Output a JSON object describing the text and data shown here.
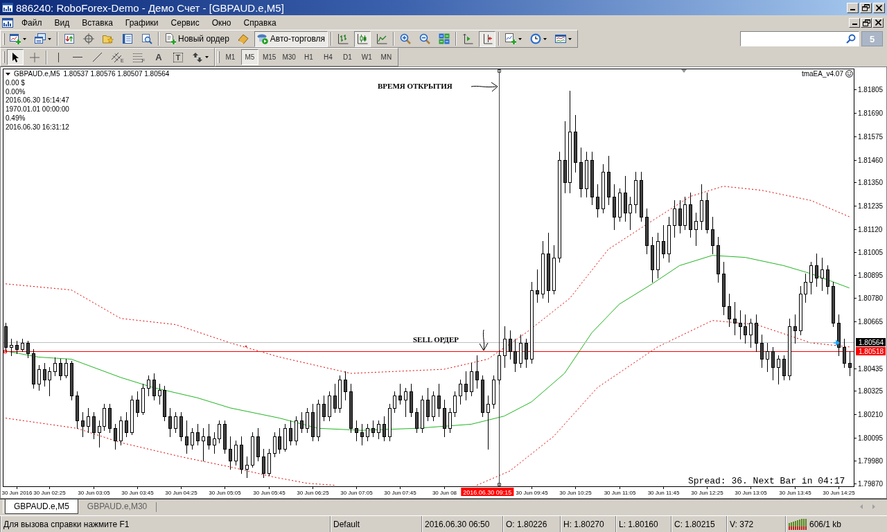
{
  "window": {
    "title": "886240: RoboForex-Demo - Демо Счет - [GBPAUD.e,M5]"
  },
  "menu": {
    "items": [
      "Файл",
      "Вид",
      "Вставка",
      "Графики",
      "Сервис",
      "Окно",
      "Справка"
    ]
  },
  "toolbar": {
    "groups": [
      [
        {
          "kind": "new-chart",
          "pressed": false,
          "dropdown": true
        },
        {
          "kind": "profiles",
          "pressed": false,
          "dropdown": true
        }
      ],
      [
        {
          "kind": "market-watch",
          "pressed": false
        },
        {
          "kind": "navigator",
          "pressed": false
        },
        {
          "kind": "favorites",
          "pressed": false
        },
        {
          "kind": "terminal",
          "pressed": false
        },
        {
          "kind": "tester",
          "pressed": false
        }
      ],
      [
        {
          "kind": "new-order",
          "label": "Новый ордер",
          "pressed": false
        },
        {
          "kind": "meta-editor",
          "pressed": false
        },
        {
          "kind": "auto-trading",
          "label": "Авто-торговля",
          "pressed": true
        }
      ],
      [
        {
          "kind": "bar-chart",
          "pressed": false
        },
        {
          "kind": "candles",
          "pressed": true
        },
        {
          "kind": "line-chart",
          "pressed": false
        }
      ],
      [
        {
          "kind": "zoom-in",
          "pressed": false
        },
        {
          "kind": "zoom-out",
          "pressed": false
        },
        {
          "kind": "tile",
          "pressed": false
        }
      ],
      [
        {
          "kind": "autoscroll",
          "pressed": false
        },
        {
          "kind": "chart-shift",
          "pressed": true
        }
      ],
      [
        {
          "kind": "indicators",
          "pressed": false,
          "dropdown": true
        },
        {
          "kind": "periods",
          "pressed": false,
          "dropdown": true
        },
        {
          "kind": "templates",
          "pressed": false,
          "dropdown": true
        }
      ]
    ],
    "messages": {
      "count": "5"
    }
  },
  "drawing_toolbar": {
    "groups": [
      [
        {
          "kind": "cursor",
          "pressed": true
        },
        {
          "kind": "crosshair",
          "pressed": false
        }
      ],
      [
        {
          "kind": "vline",
          "pressed": false
        },
        {
          "kind": "hline",
          "pressed": false
        },
        {
          "kind": "trendline",
          "pressed": false
        },
        {
          "kind": "channel",
          "letter": "E",
          "pressed": false
        },
        {
          "kind": "fibo",
          "letter": "F",
          "pressed": false
        },
        {
          "kind": "text",
          "label": "A",
          "pressed": false
        },
        {
          "kind": "label",
          "label": "T",
          "pressed": false
        },
        {
          "kind": "arrows",
          "pressed": false,
          "dropdown": true
        }
      ]
    ],
    "timeframes": [
      {
        "label": "M1",
        "selected": false
      },
      {
        "label": "M5",
        "selected": true
      },
      {
        "label": "M15",
        "selected": false
      },
      {
        "label": "M30",
        "selected": false
      },
      {
        "label": "H1",
        "selected": false
      },
      {
        "label": "H4",
        "selected": false
      },
      {
        "label": "D1",
        "selected": false
      },
      {
        "label": "W1",
        "selected": false
      },
      {
        "label": "MN",
        "selected": false
      }
    ]
  },
  "chart": {
    "header": {
      "symbol": "GBPAUD.e,M5",
      "quotes": "1.80537 1.80576 1.80507 1.80564"
    },
    "info_lines": [
      "0.00 $",
      "0.00%",
      "2016.06.30 16:14:47",
      "1970.01.01 00:00:00",
      "0.49%",
      "2016.06.30 16:31:12"
    ],
    "expert": {
      "name": "tmaEA_v4.07",
      "smiling": true
    },
    "ref_line_states": [
      {
        "selected": false
      },
      {
        "selected": true
      },
      {
        "selected": true
      }
    ],
    "chart_data": {
      "type": "candlestick",
      "x": [
        "2016-06-30T01:45",
        "2016-06-30T01:50",
        "2016-06-30T01:55",
        "2016-06-30T02:00",
        "2016-06-30T02:05",
        "2016-06-30T02:10",
        "2016-06-30T02:15",
        "2016-06-30T02:20",
        "2016-06-30T02:25",
        "2016-06-30T02:30",
        "2016-06-30T02:35",
        "2016-06-30T02:40",
        "2016-06-30T02:45",
        "2016-06-30T02:50",
        "2016-06-30T02:55",
        "2016-06-30T03:00",
        "2016-06-30T03:05",
        "2016-06-30T03:10",
        "2016-06-30T03:15",
        "2016-06-30T03:20",
        "2016-06-30T03:25",
        "2016-06-30T03:30",
        "2016-06-30T03:35",
        "2016-06-30T03:40",
        "2016-06-30T03:45",
        "2016-06-30T03:50",
        "2016-06-30T03:55",
        "2016-06-30T04:00",
        "2016-06-30T04:05",
        "2016-06-30T04:10",
        "2016-06-30T04:15",
        "2016-06-30T04:20",
        "2016-06-30T04:25",
        "2016-06-30T04:30",
        "2016-06-30T04:35",
        "2016-06-30T04:40",
        "2016-06-30T04:45",
        "2016-06-30T04:50",
        "2016-06-30T04:55",
        "2016-06-30T05:00",
        "2016-06-30T05:05",
        "2016-06-30T05:10",
        "2016-06-30T05:15",
        "2016-06-30T05:20",
        "2016-06-30T05:25",
        "2016-06-30T05:30",
        "2016-06-30T05:35",
        "2016-06-30T05:40",
        "2016-06-30T05:45",
        "2016-06-30T05:50",
        "2016-06-30T05:55",
        "2016-06-30T06:00",
        "2016-06-30T06:05",
        "2016-06-30T06:10",
        "2016-06-30T06:15",
        "2016-06-30T06:20",
        "2016-06-30T06:25",
        "2016-06-30T06:30",
        "2016-06-30T06:35",
        "2016-06-30T06:40",
        "2016-06-30T06:45",
        "2016-06-30T06:50",
        "2016-06-30T06:55",
        "2016-06-30T07:00",
        "2016-06-30T07:05",
        "2016-06-30T07:10",
        "2016-06-30T07:15",
        "2016-06-30T07:20",
        "2016-06-30T07:25",
        "2016-06-30T07:30",
        "2016-06-30T07:35",
        "2016-06-30T07:40",
        "2016-06-30T07:45",
        "2016-06-30T07:50",
        "2016-06-30T07:55",
        "2016-06-30T08:00",
        "2016-06-30T08:05",
        "2016-06-30T08:10",
        "2016-06-30T08:15",
        "2016-06-30T08:20",
        "2016-06-30T08:25",
        "2016-06-30T08:30",
        "2016-06-30T08:35",
        "2016-06-30T08:40",
        "2016-06-30T08:45",
        "2016-06-30T08:50",
        "2016-06-30T08:55",
        "2016-06-30T09:00",
        "2016-06-30T09:05",
        "2016-06-30T09:10",
        "2016-06-30T09:15",
        "2016-06-30T09:20",
        "2016-06-30T09:25",
        "2016-06-30T09:30",
        "2016-06-30T09:35",
        "2016-06-30T09:40",
        "2016-06-30T09:45",
        "2016-06-30T09:50",
        "2016-06-30T09:55",
        "2016-06-30T10:00",
        "2016-06-30T10:05",
        "2016-06-30T10:10",
        "2016-06-30T10:15",
        "2016-06-30T10:20",
        "2016-06-30T10:25",
        "2016-06-30T10:30",
        "2016-06-30T10:35",
        "2016-06-30T10:40",
        "2016-06-30T10:45",
        "2016-06-30T10:50",
        "2016-06-30T10:55",
        "2016-06-30T11:00",
        "2016-06-30T11:05",
        "2016-06-30T11:10",
        "2016-06-30T11:15",
        "2016-06-30T11:20",
        "2016-06-30T11:25",
        "2016-06-30T11:30",
        "2016-06-30T11:35",
        "2016-06-30T11:40",
        "2016-06-30T11:45",
        "2016-06-30T11:50",
        "2016-06-30T11:55",
        "2016-06-30T12:00",
        "2016-06-30T12:05",
        "2016-06-30T12:10",
        "2016-06-30T12:15",
        "2016-06-30T12:20",
        "2016-06-30T12:25",
        "2016-06-30T12:30",
        "2016-06-30T12:35",
        "2016-06-30T12:40",
        "2016-06-30T12:45",
        "2016-06-30T12:50",
        "2016-06-30T12:55",
        "2016-06-30T13:00",
        "2016-06-30T13:05",
        "2016-06-30T13:10",
        "2016-06-30T13:15",
        "2016-06-30T13:20",
        "2016-06-30T13:25",
        "2016-06-30T13:30",
        "2016-06-30T13:35",
        "2016-06-30T13:40",
        "2016-06-30T13:45",
        "2016-06-30T13:50",
        "2016-06-30T13:55",
        "2016-06-30T14:00",
        "2016-06-30T14:05",
        "2016-06-30T14:10",
        "2016-06-30T14:15",
        "2016-06-30T14:20",
        "2016-06-30T14:25",
        "2016-06-30T14:30",
        "2016-06-30T14:35"
      ],
      "ohlc": [
        [
          1.8064,
          1.8066,
          1.8052,
          1.8054
        ],
        [
          1.8054,
          1.8058,
          1.805,
          1.8055
        ],
        [
          1.8055,
          1.8057,
          1.8051,
          1.8053
        ],
        [
          1.8053,
          1.8058,
          1.8052,
          1.8056
        ],
        [
          1.8056,
          1.8057,
          1.8049,
          1.8051
        ],
        [
          1.8051,
          1.8053,
          1.8034,
          1.8036
        ],
        [
          1.8036,
          1.8045,
          1.8033,
          1.8043
        ],
        [
          1.8043,
          1.8046,
          1.8035,
          1.8038
        ],
        [
          1.8038,
          1.8044,
          1.803,
          1.8042
        ],
        [
          1.8042,
          1.8049,
          1.804,
          1.8046
        ],
        [
          1.8046,
          1.8048,
          1.8038,
          1.804
        ],
        [
          1.804,
          1.8048,
          1.8039,
          1.8046
        ],
        [
          1.8046,
          1.8047,
          1.8028,
          1.803
        ],
        [
          1.803,
          1.8032,
          1.8014,
          1.8018
        ],
        [
          1.8018,
          1.8022,
          1.801,
          1.8015
        ],
        [
          1.8015,
          1.8024,
          1.8012,
          1.802
        ],
        [
          1.802,
          1.8022,
          1.8009,
          1.8012
        ],
        [
          1.8012,
          1.8018,
          1.8005,
          1.8015
        ],
        [
          1.8015,
          1.8026,
          1.8013,
          1.8024
        ],
        [
          1.8024,
          1.8026,
          1.8012,
          1.8014
        ],
        [
          1.8014,
          1.8016,
          1.8004,
          1.8008
        ],
        [
          1.8008,
          1.802,
          1.8006,
          1.8018
        ],
        [
          1.8018,
          1.8022,
          1.801,
          1.8012
        ],
        [
          1.8012,
          1.803,
          1.8011,
          1.8028
        ],
        [
          1.8028,
          1.8032,
          1.802,
          1.8022
        ],
        [
          1.8022,
          1.8036,
          1.8021,
          1.8034
        ],
        [
          1.8034,
          1.804,
          1.803,
          1.8038
        ],
        [
          1.8038,
          1.8041,
          1.8028,
          1.803
        ],
        [
          1.803,
          1.8036,
          1.8026,
          1.8033
        ],
        [
          1.8033,
          1.8035,
          1.8018,
          1.802
        ],
        [
          1.802,
          1.8024,
          1.801,
          1.8014
        ],
        [
          1.8014,
          1.8022,
          1.8012,
          1.802
        ],
        [
          1.802,
          1.8022,
          1.8008,
          1.801
        ],
        [
          1.801,
          1.8018,
          1.8002,
          1.8006
        ],
        [
          1.8006,
          1.8014,
          1.8004,
          1.8012
        ],
        [
          1.8012,
          1.8016,
          1.8006,
          1.8008
        ],
        [
          1.8008,
          1.8014,
          1.7998,
          1.801
        ],
        [
          1.801,
          1.8016,
          1.8004,
          1.8006
        ],
        [
          1.8006,
          1.8012,
          1.8002,
          1.8009
        ],
        [
          1.8009,
          1.8018,
          1.8007,
          1.8016
        ],
        [
          1.8016,
          1.8018,
          1.8002,
          1.8004
        ],
        [
          1.8004,
          1.801,
          1.7994,
          1.7998
        ],
        [
          1.7998,
          1.8008,
          1.7996,
          1.8006
        ],
        [
          1.8006,
          1.801,
          1.7992,
          1.7994
        ],
        [
          1.7994,
          1.8,
          1.799,
          1.7996
        ],
        [
          1.7996,
          1.8012,
          1.7995,
          1.801
        ],
        [
          1.801,
          1.8014,
          1.7998,
          1.8
        ],
        [
          1.8,
          1.8004,
          1.799,
          1.7992
        ],
        [
          1.7992,
          1.8004,
          1.7991,
          1.8002
        ],
        [
          1.8002,
          1.8012,
          1.8,
          1.801
        ],
        [
          1.801,
          1.8014,
          1.8002,
          1.8004
        ],
        [
          1.8004,
          1.8016,
          1.8003,
          1.8014
        ],
        [
          1.8014,
          1.8018,
          1.8006,
          1.8008
        ],
        [
          1.8008,
          1.802,
          1.8006,
          1.8018
        ],
        [
          1.8018,
          1.8022,
          1.8012,
          1.8014
        ],
        [
          1.8014,
          1.8024,
          1.8012,
          1.8022
        ],
        [
          1.8022,
          1.8026,
          1.8008,
          1.801
        ],
        [
          1.801,
          1.8028,
          1.8008,
          1.8026
        ],
        [
          1.8026,
          1.803,
          1.8018,
          1.802
        ],
        [
          1.802,
          1.8032,
          1.8018,
          1.803
        ],
        [
          1.803,
          1.8036,
          1.8022,
          1.8024
        ],
        [
          1.8024,
          1.804,
          1.8022,
          1.8038
        ],
        [
          1.8038,
          1.8042,
          1.8028,
          1.8032
        ],
        [
          1.8032,
          1.8036,
          1.8012,
          1.8014
        ],
        [
          1.8014,
          1.8018,
          1.8008,
          1.8012
        ],
        [
          1.8012,
          1.8016,
          1.8006,
          1.801
        ],
        [
          1.801,
          1.8016,
          1.8008,
          1.8014
        ],
        [
          1.8014,
          1.8018,
          1.801,
          1.8012
        ],
        [
          1.8012,
          1.8018,
          1.8009,
          1.8016
        ],
        [
          1.8016,
          1.802,
          1.8008,
          1.801
        ],
        [
          1.801,
          1.8026,
          1.8008,
          1.8024
        ],
        [
          1.8024,
          1.8032,
          1.8022,
          1.803
        ],
        [
          1.803,
          1.8036,
          1.8026,
          1.8028
        ],
        [
          1.8028,
          1.8034,
          1.802,
          1.8032
        ],
        [
          1.8032,
          1.8036,
          1.802,
          1.8022
        ],
        [
          1.8022,
          1.8024,
          1.8012,
          1.8014
        ],
        [
          1.8014,
          1.803,
          1.8012,
          1.8028
        ],
        [
          1.8028,
          1.8034,
          1.8018,
          1.802
        ],
        [
          1.802,
          1.8032,
          1.8018,
          1.803
        ],
        [
          1.803,
          1.8036,
          1.802,
          1.8024
        ],
        [
          1.8024,
          1.8028,
          1.801,
          1.8014
        ],
        [
          1.8014,
          1.8024,
          1.8012,
          1.8022
        ],
        [
          1.8022,
          1.8032,
          1.802,
          1.803
        ],
        [
          1.803,
          1.8038,
          1.8026,
          1.8036
        ],
        [
          1.8036,
          1.8042,
          1.8028,
          1.8032
        ],
        [
          1.8032,
          1.8046,
          1.803,
          1.8042
        ],
        [
          1.8042,
          1.805,
          1.8034,
          1.8038
        ],
        [
          1.8038,
          1.804,
          1.802,
          1.8022
        ],
        [
          1.8022,
          1.803,
          1.8004,
          1.8026
        ],
        [
          1.8026,
          1.804,
          1.8024,
          1.8038
        ],
        [
          1.8038,
          1.8052,
          1.8036,
          1.805
        ],
        [
          1.805,
          1.8064,
          1.8044,
          1.8058
        ],
        [
          1.8058,
          1.8062,
          1.8048,
          1.8052
        ],
        [
          1.8052,
          1.8058,
          1.8042,
          1.8046
        ],
        [
          1.8046,
          1.806,
          1.8044,
          1.8056
        ],
        [
          1.8056,
          1.8058,
          1.8044,
          1.8048
        ],
        [
          1.8048,
          1.8086,
          1.8046,
          1.8082
        ],
        [
          1.8082,
          1.8092,
          1.8076,
          1.808
        ],
        [
          1.808,
          1.8106,
          1.8078,
          1.81
        ],
        [
          1.81,
          1.811,
          1.8076,
          1.8082
        ],
        [
          1.8082,
          1.8104,
          1.808,
          1.8098
        ],
        [
          1.8098,
          1.815,
          1.8096,
          1.8146
        ],
        [
          1.8146,
          1.8165,
          1.813,
          1.8135
        ],
        [
          1.8135,
          1.818,
          1.813,
          1.816
        ],
        [
          1.816,
          1.8168,
          1.814,
          1.8145
        ],
        [
          1.8145,
          1.8152,
          1.8128,
          1.8132
        ],
        [
          1.8132,
          1.815,
          1.8128,
          1.8146
        ],
        [
          1.8146,
          1.815,
          1.8124,
          1.8128
        ],
        [
          1.8128,
          1.8134,
          1.8118,
          1.8122
        ],
        [
          1.8122,
          1.8144,
          1.812,
          1.814
        ],
        [
          1.814,
          1.8148,
          1.8124,
          1.8128
        ],
        [
          1.8128,
          1.8134,
          1.8112,
          1.8118
        ],
        [
          1.8118,
          1.8132,
          1.8116,
          1.813
        ],
        [
          1.813,
          1.8138,
          1.8116,
          1.812
        ],
        [
          1.812,
          1.8128,
          1.8112,
          1.8124
        ],
        [
          1.8124,
          1.814,
          1.812,
          1.8136
        ],
        [
          1.8136,
          1.814,
          1.8116,
          1.8118
        ],
        [
          1.8118,
          1.8122,
          1.81,
          1.8104
        ],
        [
          1.8104,
          1.8108,
          1.8086,
          1.8092
        ],
        [
          1.8092,
          1.811,
          1.8088,
          1.8106
        ],
        [
          1.8106,
          1.8114,
          1.8098,
          1.81
        ],
        [
          1.81,
          1.8118,
          1.8096,
          1.8114
        ],
        [
          1.8114,
          1.8126,
          1.8108,
          1.8122
        ],
        [
          1.8122,
          1.8126,
          1.811,
          1.8114
        ],
        [
          1.8114,
          1.8128,
          1.8112,
          1.8124
        ],
        [
          1.8124,
          1.813,
          1.8108,
          1.8112
        ],
        [
          1.8112,
          1.812,
          1.8104,
          1.8116
        ],
        [
          1.8116,
          1.8134,
          1.8112,
          1.8126
        ],
        [
          1.8126,
          1.813,
          1.811,
          1.8112
        ],
        [
          1.8112,
          1.8118,
          1.81,
          1.8104
        ],
        [
          1.8104,
          1.8108,
          1.8086,
          1.809
        ],
        [
          1.809,
          1.8096,
          1.807,
          1.8074
        ],
        [
          1.8074,
          1.808,
          1.8064,
          1.8068
        ],
        [
          1.8068,
          1.8076,
          1.806,
          1.8066
        ],
        [
          1.8066,
          1.8072,
          1.8058,
          1.8064
        ],
        [
          1.8064,
          1.807,
          1.8056,
          1.806
        ],
        [
          1.806,
          1.8068,
          1.8054,
          1.8066
        ],
        [
          1.8066,
          1.807,
          1.8052,
          1.8056
        ],
        [
          1.8056,
          1.806,
          1.8044,
          1.8048
        ],
        [
          1.8048,
          1.8056,
          1.8042,
          1.8052
        ],
        [
          1.8052,
          1.8054,
          1.8038,
          1.8044
        ],
        [
          1.8044,
          1.805,
          1.8036,
          1.8048
        ],
        [
          1.8048,
          1.805,
          1.8038,
          1.804
        ],
        [
          1.804,
          1.8068,
          1.8038,
          1.8064
        ],
        [
          1.8064,
          1.807,
          1.8056,
          1.8062
        ],
        [
          1.8062,
          1.8084,
          1.806,
          1.808
        ],
        [
          1.808,
          1.809,
          1.8076,
          1.8086
        ],
        [
          1.8086,
          1.8096,
          1.808,
          1.8094
        ],
        [
          1.8094,
          1.81,
          1.8084,
          1.8088
        ],
        [
          1.8088,
          1.8098,
          1.8082,
          1.8092
        ],
        [
          1.8092,
          1.8094,
          1.808,
          1.8084
        ],
        [
          1.8084,
          1.8086,
          1.8064,
          1.8066
        ],
        [
          1.8066,
          1.807,
          1.805,
          1.8054
        ],
        [
          1.8054,
          1.8058,
          1.8044,
          1.8046
        ],
        [
          1.8046,
          1.8052,
          1.804,
          1.8044
        ]
      ],
      "series": [
        {
          "type": "line",
          "color": "#22b422",
          "x": [
            "2016-06-30T01:45",
            "2016-06-30T02:15",
            "2016-06-30T02:45",
            "2016-06-30T03:30",
            "2016-06-30T04:00",
            "2016-06-30T04:40",
            "2016-06-30T05:10",
            "2016-06-30T05:55",
            "2016-06-30T06:30",
            "2016-06-30T07:10",
            "2016-06-30T08:00",
            "2016-06-30T08:50",
            "2016-06-30T09:20",
            "2016-06-30T09:45",
            "2016-06-30T10:15",
            "2016-06-30T10:40",
            "2016-06-30T11:05",
            "2016-06-30T11:35",
            "2016-06-30T12:00",
            "2016-06-30T12:30",
            "2016-06-30T13:00",
            "2016-06-30T13:35",
            "2016-06-30T14:00",
            "2016-06-30T14:35"
          ],
          "values": [
            1.8052,
            1.8049,
            1.8048,
            1.8039,
            1.8034,
            1.8029,
            1.8024,
            1.8019,
            1.8014,
            1.8013,
            1.8014,
            1.8016,
            1.802,
            1.8027,
            1.8041,
            1.8061,
            1.8075,
            1.8085,
            1.8094,
            1.8099,
            1.8098,
            1.8094,
            1.809,
            1.8083
          ]
        },
        {
          "type": "line",
          "color": "#e00000",
          "line_style": "dotted",
          "x": [
            "2016-06-30T01:45",
            "2016-06-30T02:45",
            "2016-06-30T03:30",
            "2016-06-30T04:20",
            "2016-06-30T05:10",
            "2016-06-30T05:55",
            "2016-06-30T07:00",
            "2016-06-30T08:25",
            "2016-06-30T09:05",
            "2016-06-30T09:40",
            "2016-06-30T10:20",
            "2016-06-30T10:55",
            "2016-06-30T11:35",
            "2016-06-30T12:10",
            "2016-06-30T12:40",
            "2016-06-30T13:15",
            "2016-06-30T14:00",
            "2016-06-30T14:35"
          ],
          "values": [
            1.8085,
            1.8082,
            1.8068,
            1.8065,
            1.8056,
            1.8049,
            1.8041,
            1.8043,
            1.8048,
            1.8061,
            1.8078,
            1.8102,
            1.8116,
            1.8128,
            1.8133,
            1.8131,
            1.8126,
            1.8118
          ]
        },
        {
          "type": "line",
          "color": "#e00000",
          "line_style": "dotted",
          "x": [
            "2016-06-30T01:45",
            "2016-06-30T02:50",
            "2016-06-30T03:30",
            "2016-06-30T04:25",
            "2016-06-30T05:10",
            "2016-06-30T05:50",
            "2016-06-30T06:20",
            "2016-06-30T06:45"
          ],
          "values": [
            1.8019,
            1.8014,
            1.8007,
            1.8,
            1.7995,
            1.799,
            1.7987,
            1.7986
          ]
        },
        {
          "type": "line",
          "color": "#e00000",
          "line_style": "dotted",
          "x": [
            "2016-06-30T08:55",
            "2016-06-30T09:25",
            "2016-06-30T10:05",
            "2016-06-30T10:45",
            "2016-06-30T11:40",
            "2016-06-30T12:30",
            "2016-06-30T13:10",
            "2016-06-30T14:00",
            "2016-06-30T14:35"
          ],
          "values": [
            1.7986,
            1.7993,
            1.801,
            1.8034,
            1.8054,
            1.8067,
            1.8065,
            1.8056,
            1.8054
          ]
        }
      ],
      "xlim": [
        "2016-06-30T01:43",
        "2016-06-30T14:39"
      ],
      "ylim": [
        1.79855,
        1.81905
      ],
      "yticks": [
        1.81805,
        {
          "value": 1.8169,
          "label": "1.81690"
        },
        1.81575,
        {
          "value": 1.8146,
          "label": "1.81460"
        },
        {
          "value": 1.8135,
          "label": "1.81350"
        },
        1.81235,
        {
          "value": 1.8112,
          "label": "1.81120"
        },
        1.81005,
        1.80895,
        {
          "value": 1.8078,
          "label": "1.80780"
        },
        1.80665,
        1.80435,
        1.80325,
        {
          "value": 1.8021,
          "label": "1.80210"
        },
        1.80095,
        {
          "value": 1.7998,
          "label": "1.79980"
        },
        {
          "value": 1.7987,
          "label": "1.79870"
        }
      ],
      "xticks": [
        {
          "value": "2016-06-30T01:55",
          "label": "30 Jun 2016"
        },
        {
          "value": "2016-06-30T02:25",
          "label": "30 Jun 02:25"
        },
        {
          "value": "2016-06-30T03:05",
          "label": "30 Jun 03:05"
        },
        {
          "value": "2016-06-30T03:45",
          "label": "30 Jun 03:45"
        },
        {
          "value": "2016-06-30T04:25",
          "label": "30 Jun 04:25"
        },
        {
          "value": "2016-06-30T05:05",
          "label": "30 Jun 05:05"
        },
        {
          "value": "2016-06-30T05:45",
          "label": "30 Jun 05:45"
        },
        {
          "value": "2016-06-30T06:25",
          "label": "30 Jun 06:25"
        },
        {
          "value": "2016-06-30T07:05",
          "label": "30 Jun 07:05"
        },
        {
          "value": "2016-06-30T07:45",
          "label": "30 Jun 07:45"
        },
        {
          "value": "2016-06-30T08:25",
          "label": "30 Jun 08"
        },
        {
          "value": "2016-06-30T09:45",
          "label": "30 Jun 09:45"
        },
        {
          "value": "2016-06-30T10:25",
          "label": "30 Jun 10:25"
        },
        {
          "value": "2016-06-30T11:05",
          "label": "30 Jun 11:05"
        },
        {
          "value": "2016-06-30T11:45",
          "label": "30 Jun 11:45"
        },
        {
          "value": "2016-06-30T12:25",
          "label": "30 Jun 12:25"
        },
        {
          "value": "2016-06-30T13:05",
          "label": "30 Jun 13:05"
        },
        {
          "value": "2016-06-30T13:45",
          "label": "30 Jun 13:45"
        },
        {
          "value": "2016-06-30T14:25",
          "label": "30 Jun 14:25"
        }
      ],
      "ref_lines": [
        {
          "axis": "y",
          "value": 1.80564,
          "label": "1.80564",
          "color": "#c0c0c0"
        },
        {
          "axis": "y",
          "value": 1.80518,
          "label": "1.80518",
          "color": "#ff0000"
        },
        {
          "axis": "x",
          "value": "2016-06-30T09:15",
          "label": "2016.06.30 09:15",
          "color": "#404040"
        }
      ],
      "annotations": [
        "ВРЕМЯ ОТКРЫТИЯ",
        "SELL ОРДЕР",
        "Spread: 36. Next Bar in 04:17"
      ]
    }
  },
  "tabs": [
    {
      "label": "GBPAUD.e,M5",
      "selected": true
    },
    {
      "label": "GBPAUD.e,M30",
      "selected": false
    }
  ],
  "status_bar": {
    "hint": "Для вызова справки нажмите F1",
    "profile": "Default",
    "bar_time": "2016.06.30 06:50",
    "open": "O: 1.80226",
    "high": "H: 1.80270",
    "low": "L: 1.80160",
    "close": "C: 1.80215",
    "volume": "V: 372",
    "traffic": "606/1 kb"
  }
}
